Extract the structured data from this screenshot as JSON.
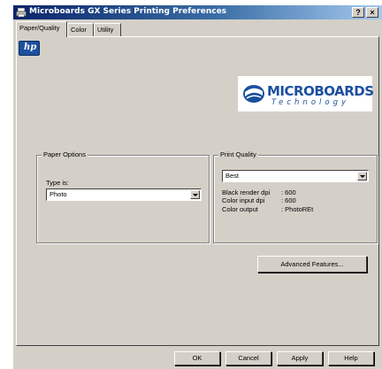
{
  "window": {
    "title": "Microboards GX Series Printing Preferences",
    "help_glyph": "?",
    "close_glyph": "×"
  },
  "tabs": [
    {
      "label": "Paper/Quality",
      "active": true
    },
    {
      "label": "Color",
      "active": false
    },
    {
      "label": "Utility",
      "active": false
    }
  ],
  "hp_logo": {
    "text": "hp"
  },
  "brand_logo": {
    "line1": "MICROBOARDS",
    "line2": "Technology"
  },
  "paper_options": {
    "group_label": "Paper Options",
    "type_label": "Type is:",
    "type_value": "Photo"
  },
  "print_quality": {
    "group_label": "Print Quality",
    "quality_value": "Best",
    "info": [
      {
        "key": "Black render dpi",
        "value": ": 600"
      },
      {
        "key": "Color input dpi",
        "value": ": 600"
      },
      {
        "key": "Color output",
        "value": ": PhotoREt"
      }
    ]
  },
  "buttons": {
    "advanced": "Advanced Features...",
    "ok": "OK",
    "cancel": "Cancel",
    "apply": "Apply",
    "help": "Help"
  },
  "colors": {
    "titlebar_start": "#0a246a",
    "titlebar_end": "#a6caf0",
    "face": "#d4d0c8",
    "brand_blue": "#1c4f9e"
  }
}
